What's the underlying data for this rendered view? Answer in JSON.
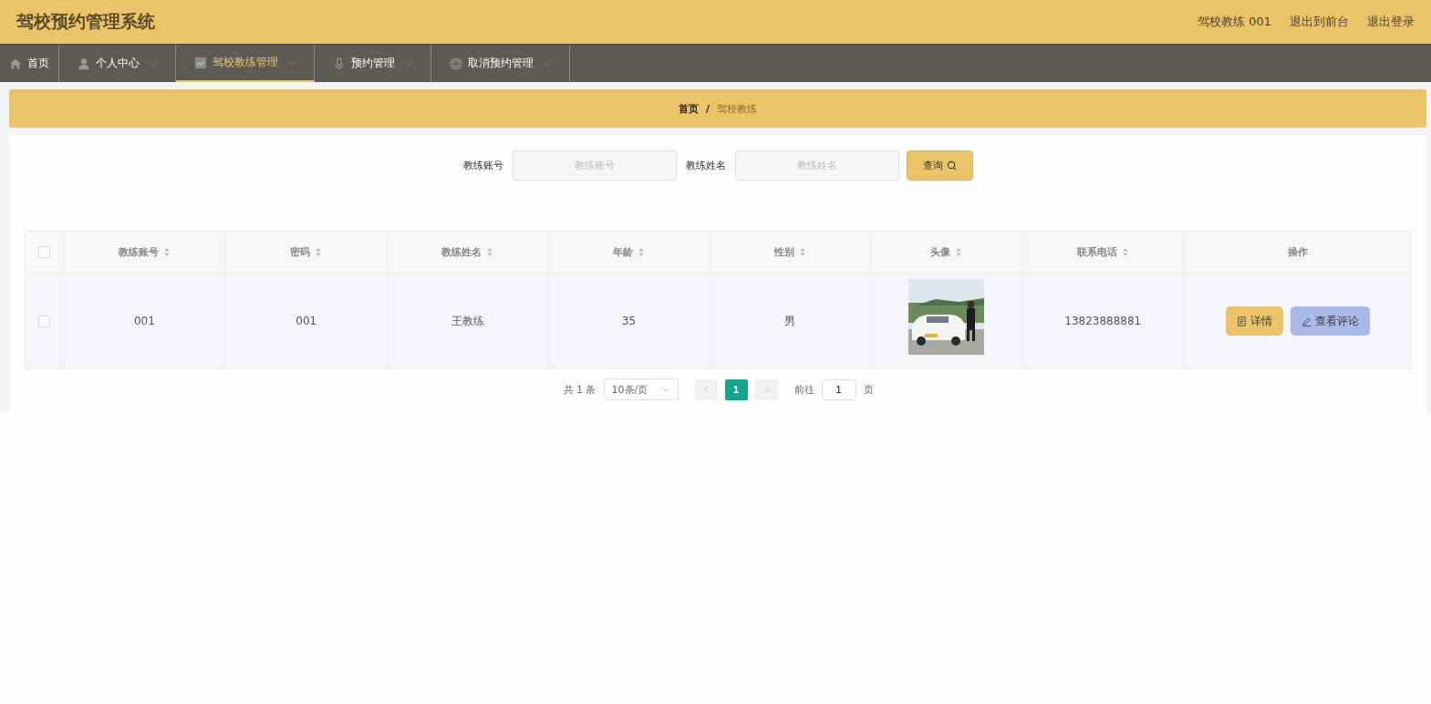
{
  "header": {
    "title": "驾校预约管理系统",
    "links": [
      "驾校教练 001",
      "退出到前台",
      "退出登录"
    ]
  },
  "nav": [
    {
      "label": "首页",
      "dropdown": false,
      "selected": false
    },
    {
      "label": "个人中心",
      "dropdown": true,
      "selected": false
    },
    {
      "label": "驾校教练管理",
      "dropdown": true,
      "selected": true
    },
    {
      "label": "预约管理",
      "dropdown": true,
      "selected": false
    },
    {
      "label": "取消预约管理",
      "dropdown": true,
      "selected": false
    }
  ],
  "breadcrumb": [
    {
      "label": "首页",
      "current": false
    },
    {
      "label": "驾校教练",
      "current": true
    }
  ],
  "breadcrumb_separator": "/",
  "search": {
    "fields": [
      {
        "label": "教练账号",
        "placeholder": "教练账号"
      },
      {
        "label": "教练姓名",
        "placeholder": "教练姓名"
      }
    ],
    "button": "查询"
  },
  "table": {
    "columns": [
      {
        "label": "教练账号",
        "sortable": true
      },
      {
        "label": "密码",
        "sortable": true
      },
      {
        "label": "教练姓名",
        "sortable": true
      },
      {
        "label": "年龄",
        "sortable": true
      },
      {
        "label": "性别",
        "sortable": true
      },
      {
        "label": "头像",
        "sortable": true
      },
      {
        "label": "联系电话",
        "sortable": true
      },
      {
        "label": "操作",
        "sortable": false
      }
    ],
    "all_checked": false,
    "rows": [
      {
        "checked": false,
        "cells": [
          {
            "kind": "text",
            "text": "001"
          },
          {
            "kind": "text",
            "text": "001"
          },
          {
            "kind": "text",
            "text": "王教练"
          },
          {
            "kind": "text",
            "text": "35"
          },
          {
            "kind": "text",
            "text": "男"
          },
          {
            "kind": "picture"
          },
          {
            "kind": "text",
            "text": "13823888881"
          },
          {
            "kind": "actions",
            "actions": [
              {
                "kind": "detail",
                "label": "详情"
              },
              {
                "kind": "review",
                "label": "查看评论"
              }
            ]
          }
        ]
      }
    ]
  },
  "pagination": {
    "total": "共 1 条",
    "page_size": "10条/页",
    "pages": [
      {
        "label": "1",
        "selected": true
      }
    ],
    "goto_label": "前往",
    "goto_value": "1",
    "goto_suffix": "页"
  }
}
